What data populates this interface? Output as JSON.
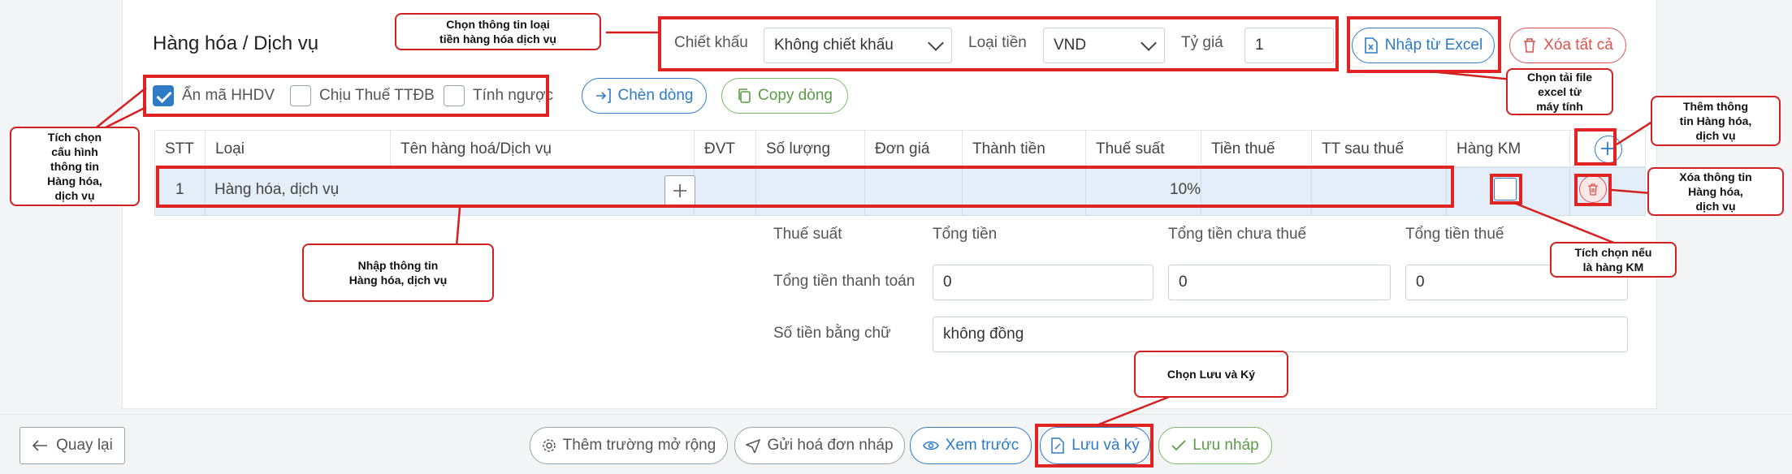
{
  "section_title": "Hàng hóa / Dịch vụ",
  "discount": {
    "label": "Chiết khấu",
    "value": "Không chiết khấu"
  },
  "currency": {
    "label": "Loại tiền",
    "value": "VND"
  },
  "rate": {
    "label": "Tỷ giá",
    "value": "1"
  },
  "buttons": {
    "import_excel": "Nhập từ Excel",
    "delete_all": "Xóa tất cả",
    "insert_row": "Chèn dòng",
    "copy_row": "Copy dòng"
  },
  "options": {
    "hide_code": {
      "label": "Ẩn mã HHDV",
      "checked": true
    },
    "special_tax": {
      "label": "Chịu Thuế TTĐB",
      "checked": false
    },
    "reverse_calc": {
      "label": "Tính ngược",
      "checked": false
    }
  },
  "table": {
    "headers": [
      "STT",
      "Loại",
      "Tên hàng hoá/Dịch vụ",
      "ĐVT",
      "Số lượng",
      "Đơn giá",
      "Thành tiền",
      "Thuế suất",
      "Tiền thuế",
      "TT sau thuế",
      "Hàng KM"
    ],
    "rows": [
      {
        "stt": "1",
        "type": "Hàng hóa, dịch vụ",
        "tax_rate": "10%"
      }
    ]
  },
  "summary": {
    "tax_rate_label": "Thuế suất",
    "total_label": "Tổng tiền",
    "pre_tax_label": "Tổng tiền chưa thuế",
    "tax_total_label": "Tổng tiền thuế",
    "payment_label": "Tổng tiền thanh toán",
    "pre_tax_value": "0",
    "tax_value": "0",
    "tax_total_value": "0",
    "in_words_label": "Số tiền bằng chữ",
    "in_words_value": "không đồng"
  },
  "footer": {
    "back": "Quay lại",
    "extra_fields": "Thêm trường mở rộng",
    "send_draft": "Gửi hoá đơn nháp",
    "preview": "Xem trước",
    "save_sign": "Lưu và ký",
    "save_draft": "Lưu nháp"
  },
  "callouts": {
    "currency_info": "Chọn thông tin loại\ntiền hàng hóa dịch vụ",
    "config": "Tích chọn\ncấu hình\nthông tin\nHàng hóa,\ndịch vụ",
    "excel": "Chọn tải file\nexcel từ\nmáy tính",
    "add_item": "Thêm thông\ntin Hàng hóa,\ndịch vụ",
    "delete_item": "Xóa thông tin\nHàng hóa,\ndịch vụ",
    "enter_item": "Nhập thông tin\nHàng hóa, dịch vụ",
    "promo": "Tích chọn nếu\nlà hàng KM",
    "save_sign": "Chọn Lưu và Ký"
  },
  "colors": {
    "accent": "#2e7bc6",
    "danger": "#d9534f",
    "success": "#5b9b47",
    "annotation": "#e02424",
    "row_bg": "#e3eef8"
  }
}
